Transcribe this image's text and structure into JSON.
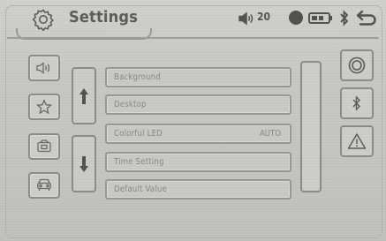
{
  "header": {
    "title": "Settings",
    "volume_value": "20",
    "icons": [
      "settings-gear-icon",
      "volume-icon",
      "status-circle-icon",
      "battery-icon",
      "bluetooth-icon",
      "back-icon"
    ]
  },
  "sidebar": {
    "items": [
      {
        "name": "sound",
        "icon": "speaker-icon"
      },
      {
        "name": "favorites",
        "icon": "star-icon"
      },
      {
        "name": "media",
        "icon": "media-icon"
      },
      {
        "name": "vehicle",
        "icon": "vehicle-icon"
      }
    ]
  },
  "menu": {
    "items": [
      {
        "label": "Background",
        "value": ""
      },
      {
        "label": "Desktop",
        "value": ""
      },
      {
        "label": "Colorful LED",
        "value": "AUTO"
      },
      {
        "label": "Time Setting",
        "value": ""
      },
      {
        "label": "Default Value",
        "value": ""
      }
    ]
  },
  "scroll": {
    "up_icon": "arrow-up-icon",
    "down_icon": "arrow-down-icon"
  },
  "right_panel": {
    "icons": [
      "record-icon",
      "bluetooth-icon",
      "warning-icon"
    ]
  },
  "colors": {
    "background": "#c9c7c1",
    "border": "#8e8c86",
    "text": "#5e5d59",
    "muted_text": "#8b8984"
  }
}
